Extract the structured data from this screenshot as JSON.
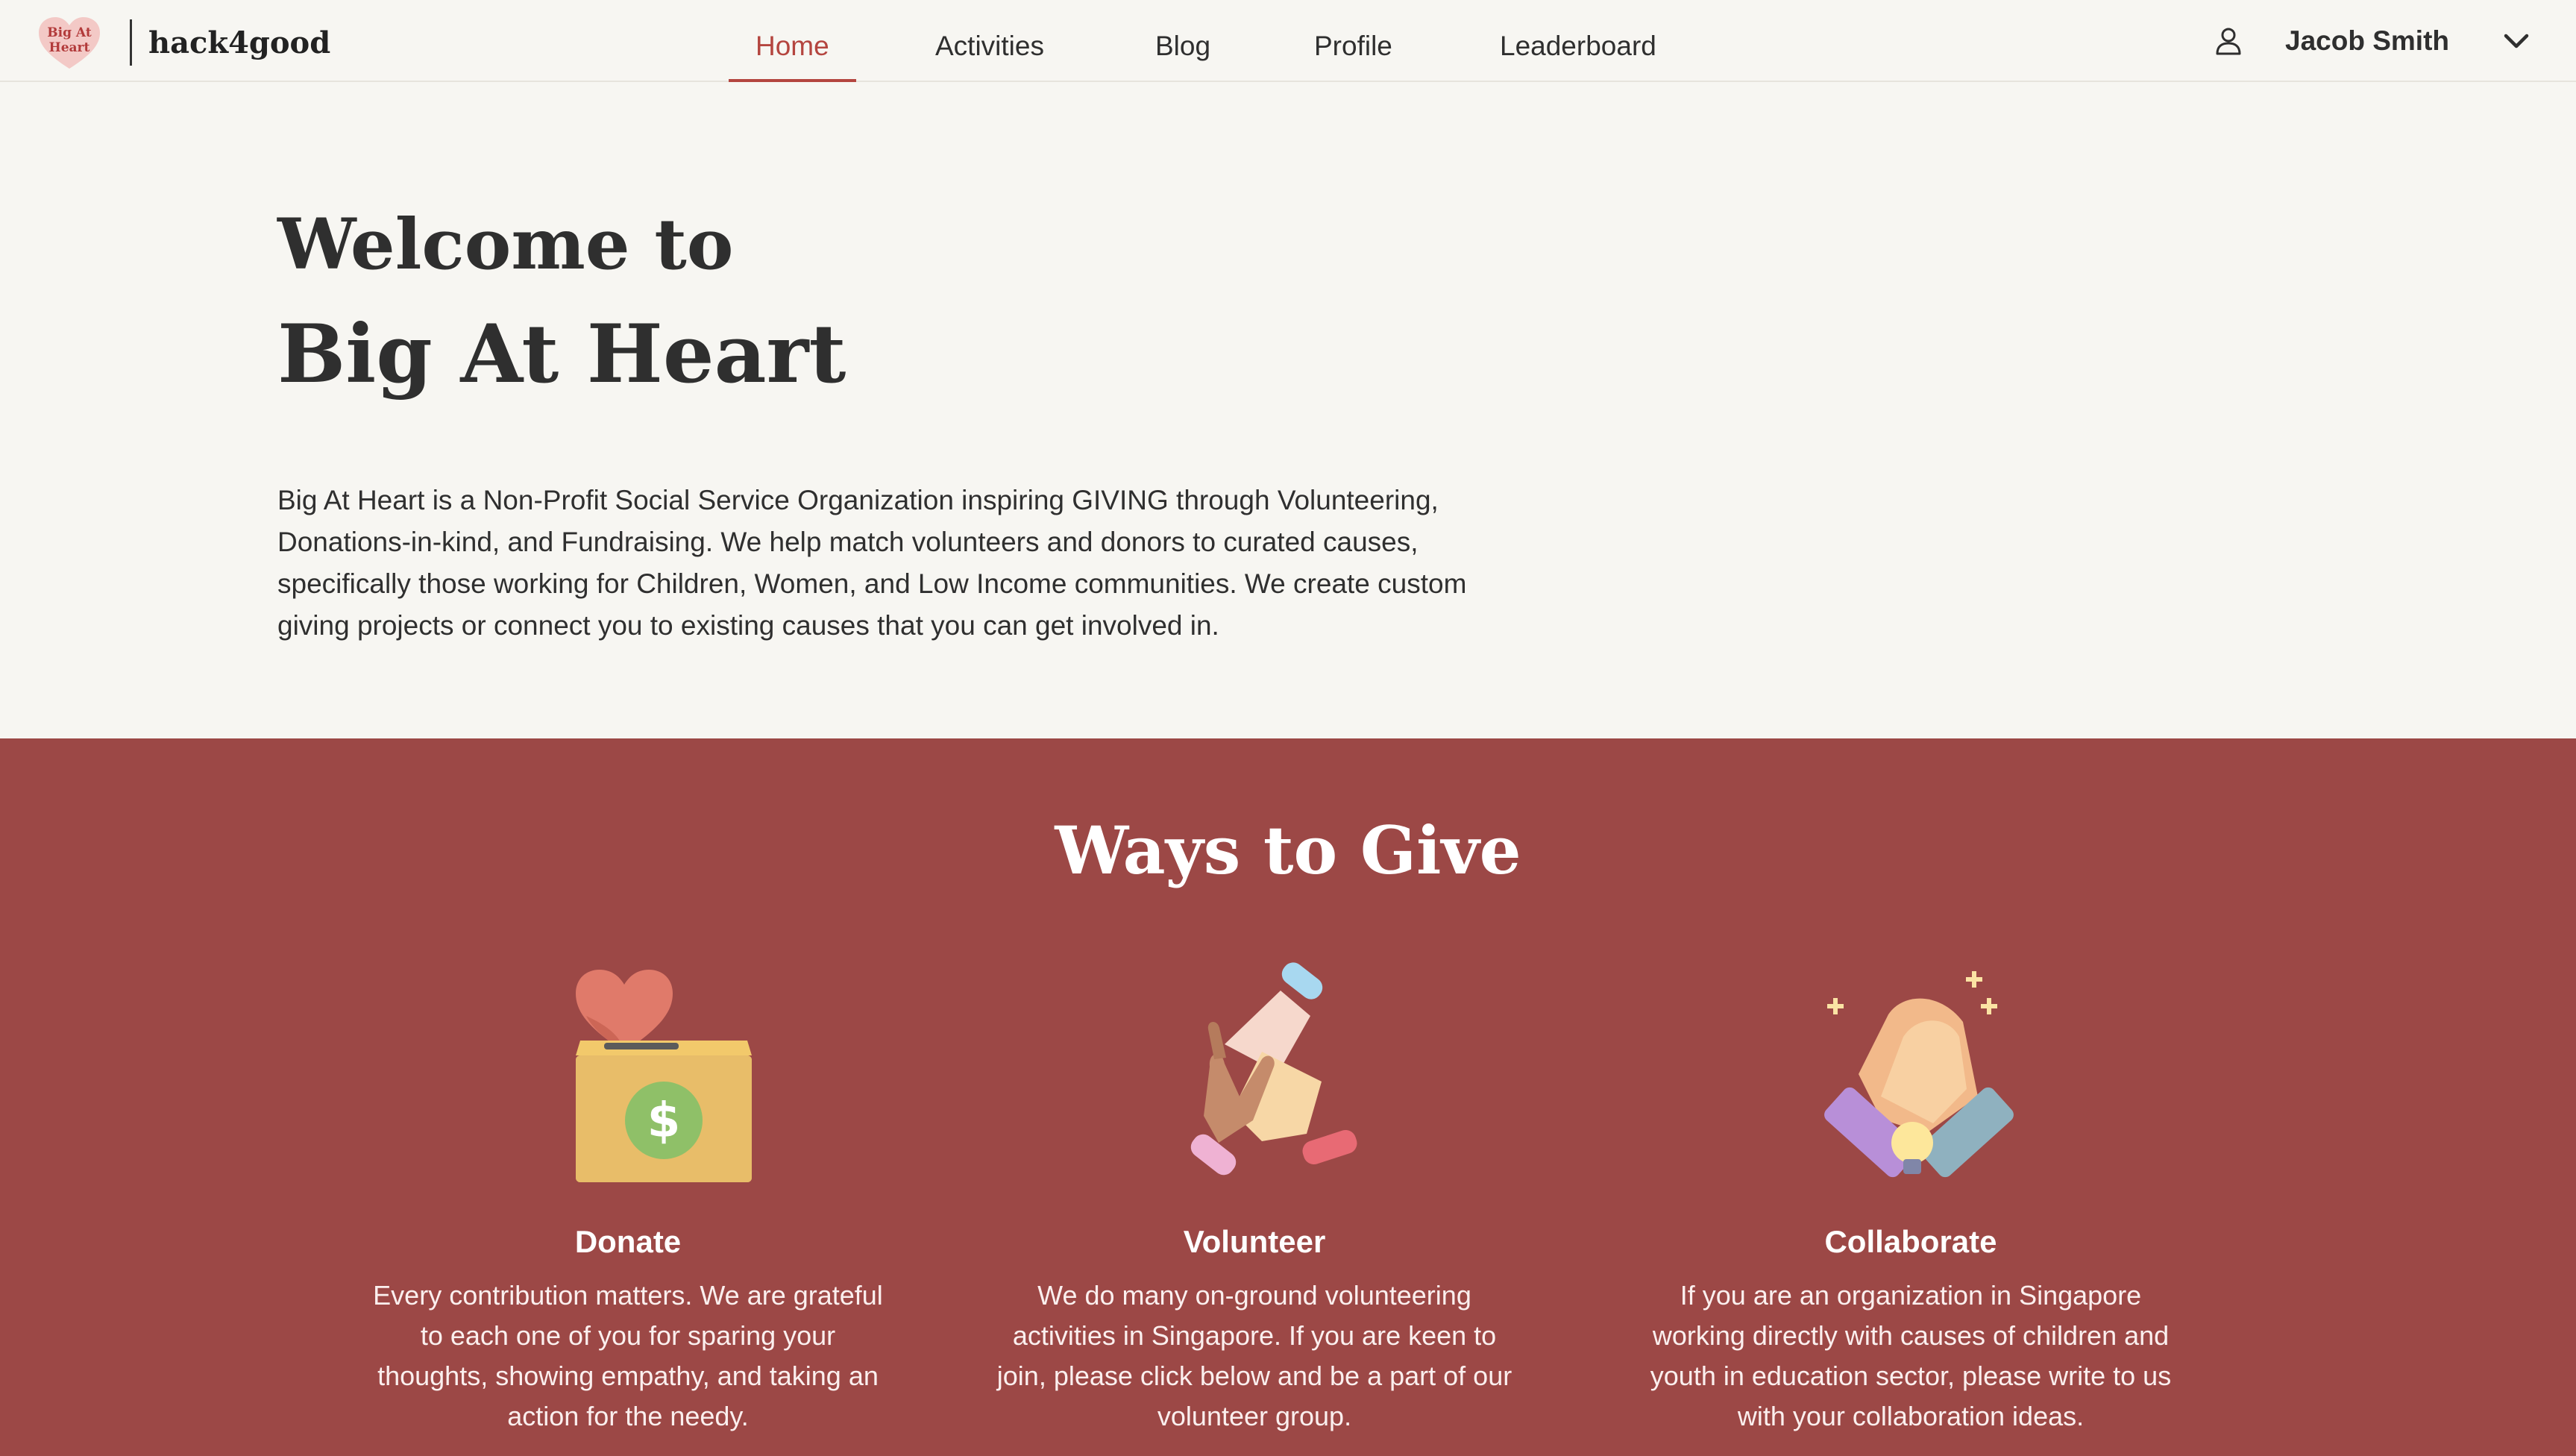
{
  "brand": {
    "logo_line1": "Big At",
    "logo_line2": "Heart",
    "name": "hack4good"
  },
  "nav": {
    "items": [
      {
        "label": "Home",
        "active": true
      },
      {
        "label": "Activities",
        "active": false
      },
      {
        "label": "Blog",
        "active": false
      },
      {
        "label": "Profile",
        "active": false
      },
      {
        "label": "Leaderboard",
        "active": false
      }
    ]
  },
  "user": {
    "icon": "user-icon",
    "name": "Jacob Smith",
    "menu_icon": "chevron-down-icon"
  },
  "hero": {
    "welcome": "Welcome to",
    "org_name": "Big At Heart",
    "intro": "Big At Heart is a Non-Profit Social Service Organization inspiring GIVING through Volunteering, Donations-in-kind, and Fundraising. We help match volunteers and donors to curated causes, specifically those working for Children, Women, and Low Income communities. We create custom giving projects or connect you to existing causes that you can get involved in."
  },
  "ways": {
    "title": "Ways to Give",
    "cards": [
      {
        "title": "Donate",
        "icon": "donation-box-icon",
        "description": "Every contribution matters. We are grateful to each one of you for sparing your thoughts, showing empathy, and taking an action for the needy."
      },
      {
        "title": "Volunteer",
        "icon": "stacked-hands-icon",
        "description": "We do many on-ground volunteering activities in Singapore. If you are keen to join, please click below and be a part of our volunteer group."
      },
      {
        "title": "Collaborate",
        "icon": "handshake-icon",
        "description": "If you are an organization in Singapore working directly with causes of children and youth in education sector, please write to us with your collaboration ideas."
      }
    ]
  },
  "colors": {
    "accent": "#b4453f",
    "section_bg": "#9c4846",
    "page_bg": "#f7f6f2"
  }
}
